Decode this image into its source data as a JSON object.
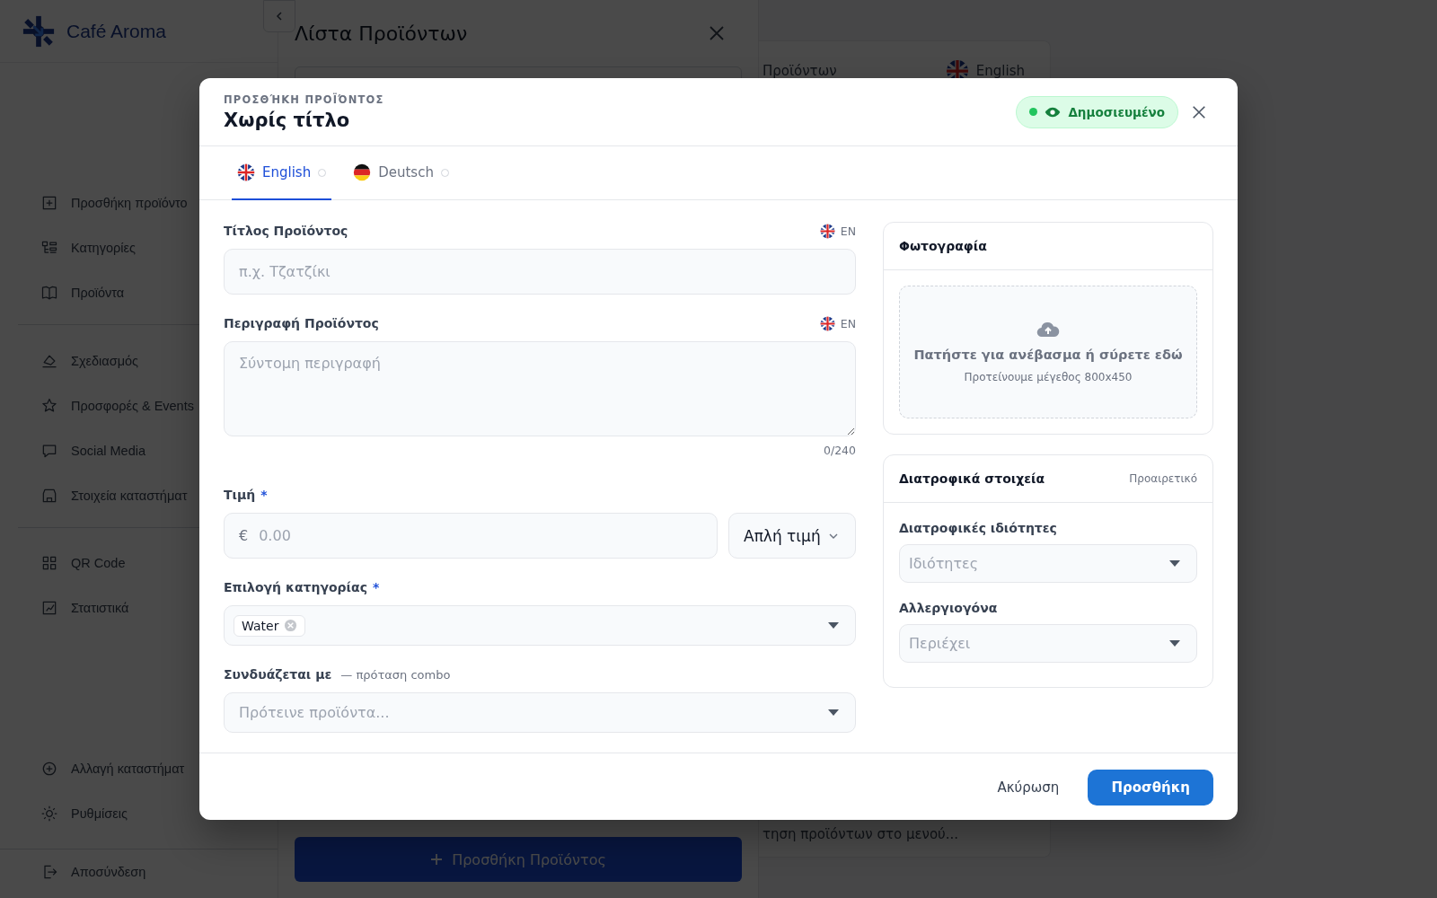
{
  "brand": {
    "name": "Café Aroma"
  },
  "sidebar": {
    "groups": [
      {
        "items": [
          {
            "label": "Προσθήκη προϊόντο"
          },
          {
            "label": "Κατηγορίες"
          },
          {
            "label": "Προϊόντα"
          }
        ]
      },
      {
        "items": [
          {
            "label": "Σχεδιασμός"
          },
          {
            "label": "Προσφορές & Events"
          },
          {
            "label": "Social Media"
          },
          {
            "label": "Στοιχεία καταστήματ"
          }
        ]
      },
      {
        "items": [
          {
            "label": "QR Code"
          },
          {
            "label": "Στατιστικά"
          }
        ]
      }
    ],
    "bottom_items": [
      {
        "label": "Αλλαγή καταστήματ"
      },
      {
        "label": "Ρυθμίσεις"
      }
    ],
    "logout": "Αποσύνδεση"
  },
  "drawer": {
    "title": "Λίστα Προϊόντων",
    "add_button": "Προσθήκη Προϊόντος"
  },
  "background_card": {
    "heading": "Προϊόντων",
    "language": "English",
    "footer_text": "τηση προϊόντων στο μενού..."
  },
  "modal": {
    "eyebrow": "ΠΡΟΣΘΉΚΗ ΠΡΟΪΌΝΤΟΣ",
    "title": "Χωρίς τίτλο",
    "status": {
      "label": "Δημοσιευμένο",
      "published": true
    },
    "tabs": [
      {
        "label": "English",
        "selected": true,
        "complete": false
      },
      {
        "label": "Deutsch",
        "selected": false,
        "complete": false
      }
    ],
    "fields": [
      {
        "kind": "text",
        "label": "Τίτλος Προϊόντος",
        "lang": "EN",
        "placeholder": "π.χ. Τζατζίκι"
      },
      {
        "kind": "textarea",
        "label": "Περιγραφή Προϊόντος",
        "lang": "EN",
        "placeholder": "Σύντομη περιγραφή",
        "counter": "0/240"
      },
      {
        "kind": "price",
        "label": "Τιμή",
        "required_mark": "*",
        "currency": "€",
        "placeholder": "0.00",
        "price_type": "Απλή τιμή"
      },
      {
        "kind": "multiselect",
        "label": "Επιλογή κατηγορίας",
        "required_mark": "*",
        "chips": [
          "Water"
        ]
      },
      {
        "kind": "select",
        "label": "Συνδυάζεται με",
        "hint": "— πρόταση combo",
        "placeholder": "Πρότεινε προϊόντα..."
      }
    ],
    "photo": {
      "title": "Φωτογραφία",
      "upload_text": "Πατήστε για ανέβασμα ή σύρετε εδώ",
      "upload_hint": "Προτείνουμε μέγεθος 800x450"
    },
    "nutrition": {
      "title": "Διατροφικά στοιχεία",
      "optional_label": "Προαιρετικό",
      "fields": [
        {
          "label": "Διατροφικές ιδιότητες",
          "placeholder": "Ιδιότητες"
        },
        {
          "label": "Αλλεργιογόνα",
          "placeholder": "Περιέχει"
        }
      ]
    },
    "cancel_button": "Ακύρωση",
    "submit_button": "Προσθήκη"
  }
}
